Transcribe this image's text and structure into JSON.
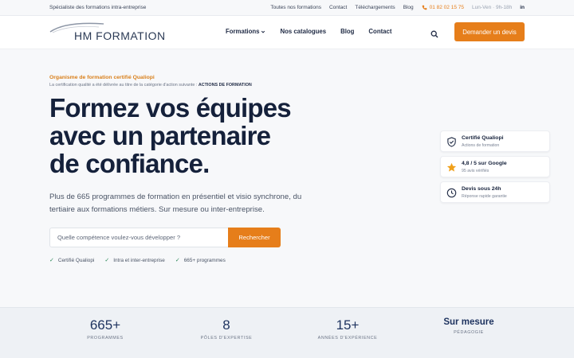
{
  "topbar": {
    "tagline": "Spécialiste des formations intra-entreprise",
    "links": [
      "Toutes nos formations",
      "Contact",
      "Téléchargements",
      "Blog"
    ],
    "phone": "01 82 02 15 75",
    "hours": "Lun-Ven · 9h-18h",
    "social": "in"
  },
  "header": {
    "logo_text": "HM FORMATION",
    "nav": [
      "Formations",
      "Nos catalogues",
      "Blog",
      "Contact"
    ],
    "cta": "Demander un devis"
  },
  "hero": {
    "kicker": "Organisme de formation certifié Qualiopi",
    "subkicker_prefix": "La certification qualité a été délivrée au titre de la catégorie d'action suivante : ",
    "subkicker_strong": "ACTIONS DE FORMATION",
    "headline": [
      "Formez vos équipes",
      "avec un partenaire",
      "de confiance."
    ],
    "lead": "Plus de 665 programmes de formation en présentiel et visio synchrone, du tertiaire aux formations métiers. Sur mesure ou inter-entreprise.",
    "search_placeholder": "Quelle compétence voulez-vous développer ?",
    "search_button": "Rechercher",
    "checks": [
      "Certifié Qualiopi",
      "Intra et inter-entreprise",
      "665+ programmes"
    ]
  },
  "cards": [
    {
      "title": "Certifié Qualiopi",
      "subtitle": "Actions de formation",
      "icon": "shield-check-icon"
    },
    {
      "title": "4,8 / 5 sur Google",
      "subtitle": "95 avis vérifiés",
      "icon": "star-icon"
    },
    {
      "title": "Devis sous 24h",
      "subtitle": "Réponse rapide garantie",
      "icon": "clock-icon"
    }
  ],
  "stats": [
    {
      "value": "665+",
      "label": "PROGRAMMES"
    },
    {
      "value": "8",
      "label": "PÔLES D'EXPERTISE"
    },
    {
      "value": "15+",
      "label": "ANNÉES D'EXPÉRIENCE"
    },
    {
      "value": "Sur mesure",
      "label": "PÉDAGOGIE"
    }
  ],
  "colors": {
    "accent": "#e67e1a",
    "navy": "#15213b",
    "check_green": "#2f8a5b"
  }
}
